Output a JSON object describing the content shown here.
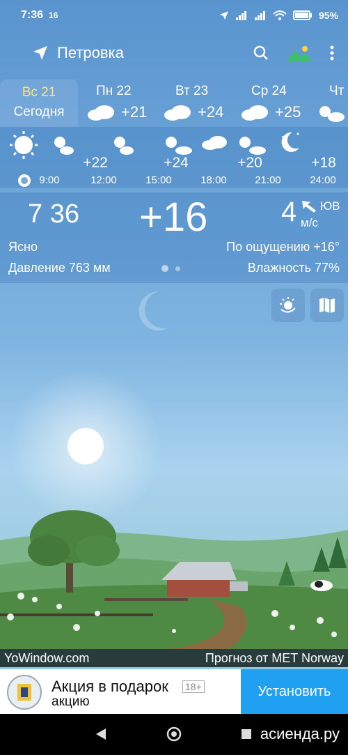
{
  "status_bar": {
    "time": "7:36",
    "notification": "16",
    "battery": "95%"
  },
  "app_bar": {
    "location": "Петровка"
  },
  "days": [
    {
      "name": "Вс 21",
      "sub": "Сегодня",
      "active": true
    },
    {
      "name": "Пн 22",
      "temp": "+21",
      "icon": "cloudy-icon"
    },
    {
      "name": "Вт 23",
      "temp": "+24",
      "icon": "cloudy-icon"
    },
    {
      "name": "Ср 24",
      "temp": "+25",
      "icon": "cloudy-icon"
    },
    {
      "name": "Чт",
      "icon": "partly-cloudy-icon"
    }
  ],
  "hourly": {
    "temps": [
      "+22",
      "+24",
      "+20",
      "+18"
    ],
    "times": [
      "9:00",
      "12:00",
      "15:00",
      "18:00",
      "21:00",
      "24:00"
    ]
  },
  "current": {
    "local_time": "7 36",
    "temperature": "+16",
    "wind_speed": "4",
    "wind_dir": "ЮВ",
    "wind_unit": "м/с",
    "condition": "Ясно",
    "feels_like": "По ощущению +16°",
    "pressure": "Давление 763 мм",
    "humidity": "Влажность 77%"
  },
  "footer": {
    "left": "YoWindow.com",
    "right": "Прогноз от MET Norway"
  },
  "ad": {
    "title": "Акция в подарок",
    "subtitle": "акцию",
    "age": "18+",
    "button": "Установить"
  },
  "watermark": "асиенда.ру",
  "colors": {
    "sky_top": "#5d9ad4",
    "sky_mid": "#7fb7e3",
    "ground": "#4f8a45",
    "accent_day": "#ffe27a",
    "install_btn": "#1fa0f0"
  }
}
